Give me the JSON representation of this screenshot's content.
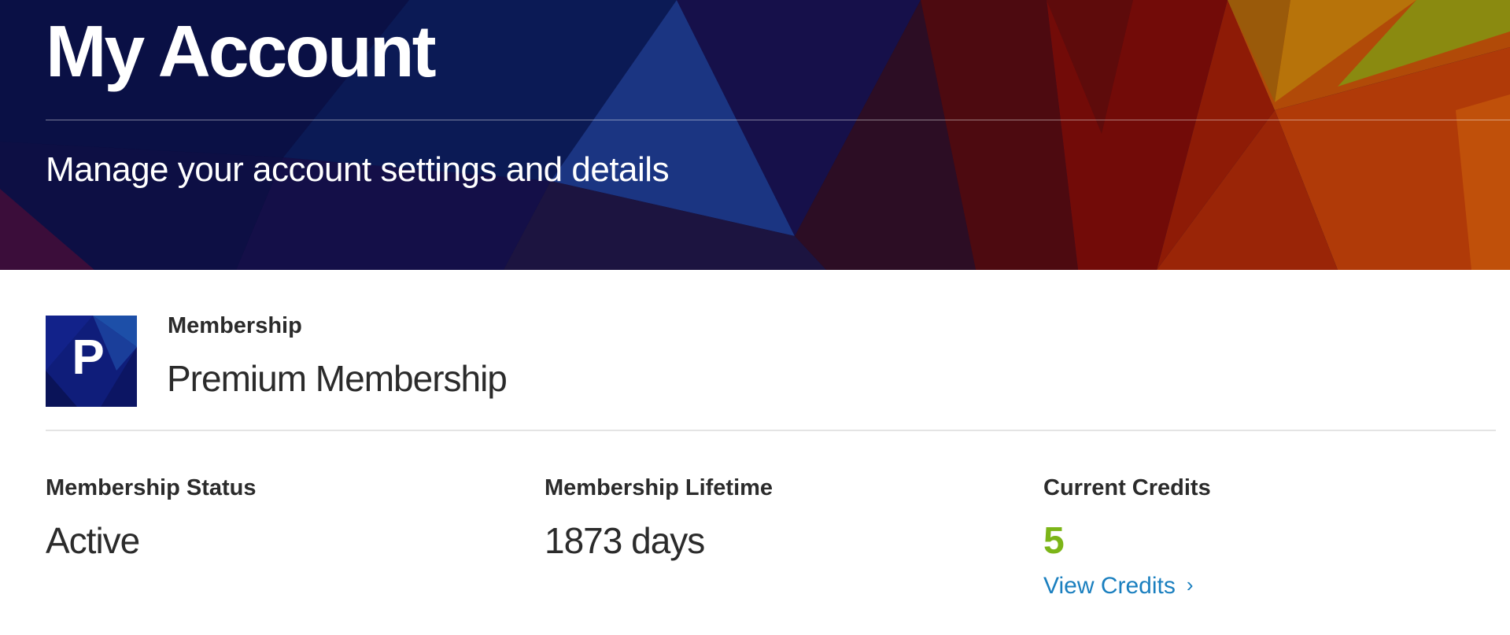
{
  "header": {
    "title": "My Account",
    "subtitle": "Manage your account settings and details"
  },
  "membership": {
    "label": "Membership",
    "plan_name": "Premium Membership",
    "logo_letter": "P"
  },
  "stats": {
    "status_label": "Membership Status",
    "status_value": "Active",
    "lifetime_label": "Membership Lifetime",
    "lifetime_value": "1873 days",
    "credits_label": "Current Credits",
    "credits_value": "5",
    "view_credits_label": "View Credits",
    "view_credits_icon": "chevron-right-icon"
  },
  "colors": {
    "credits_accent": "#7cb518",
    "link": "#1a7fbf",
    "text": "#2b2b2b"
  }
}
